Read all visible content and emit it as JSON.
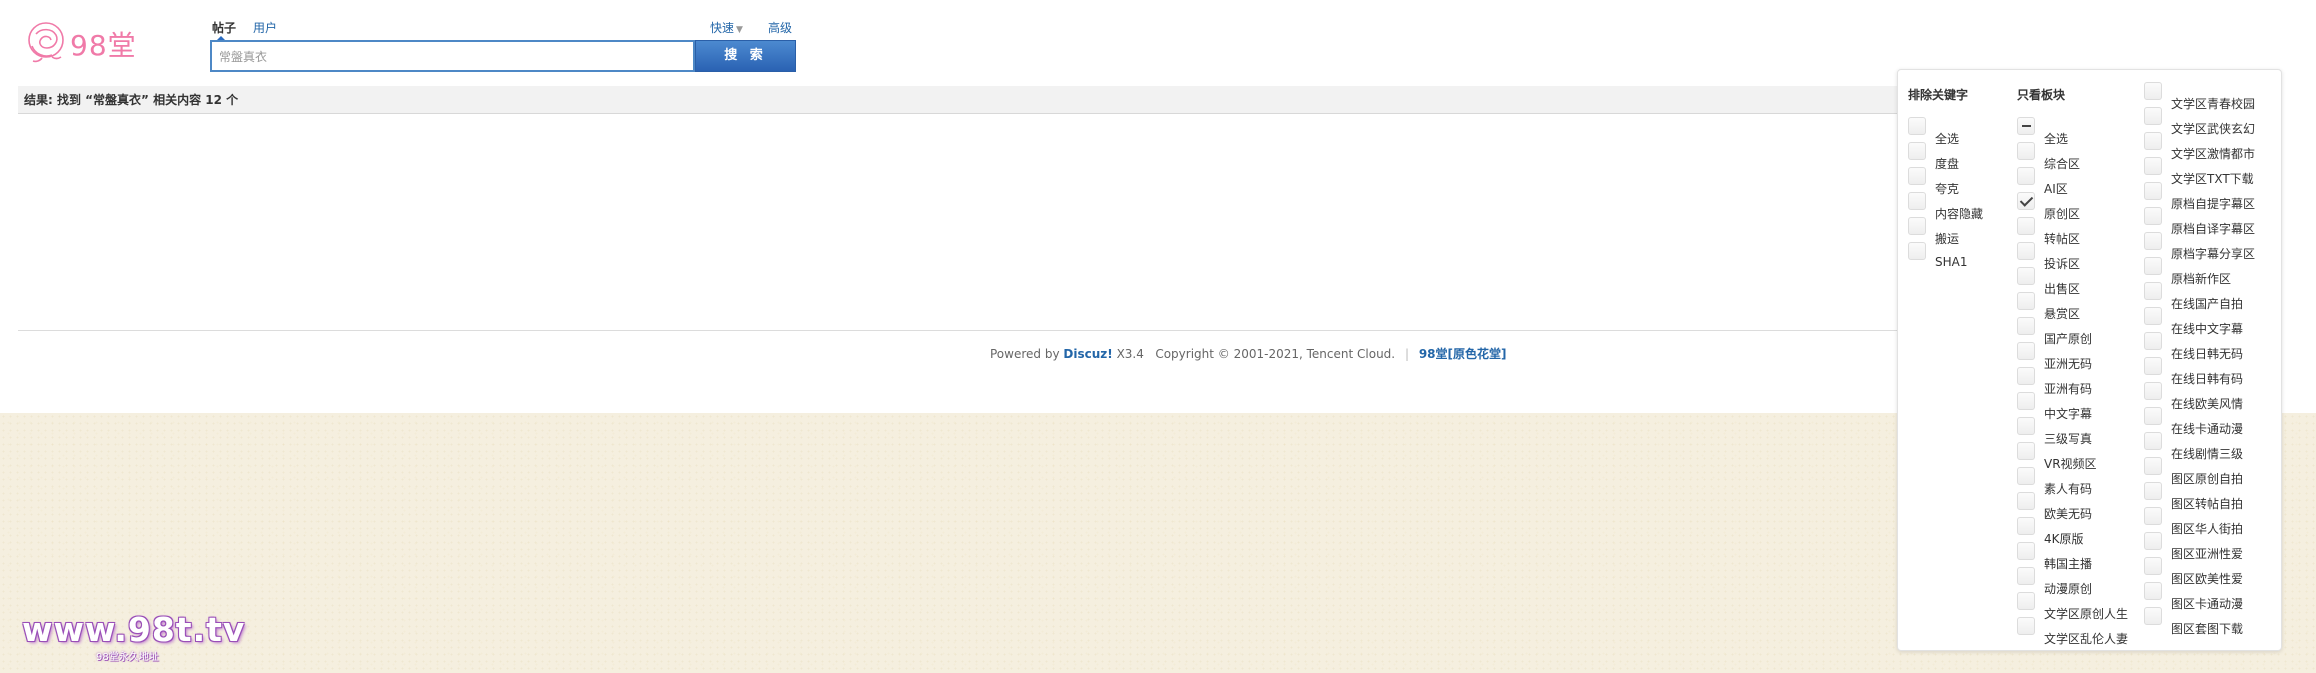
{
  "logo": {
    "text": "98堂"
  },
  "search": {
    "tabs": [
      {
        "label": "帖子",
        "active": true
      },
      {
        "label": "用户",
        "active": false
      }
    ],
    "query": "常盤真衣",
    "button_label": "搜 索",
    "quick_label": "快速",
    "advanced_label": "高级"
  },
  "result": {
    "summary": "结果: 找到 “常盤真衣” 相关内容 12 个"
  },
  "footer": {
    "powered_by": "Powered by",
    "discuz": "Discuz!",
    "version": "X3.4",
    "copyright": "Copyright © 2001-2021, Tencent Cloud.",
    "separator": "|",
    "site_name": "98堂[原色花堂]"
  },
  "watermark": {
    "main": "www.98t.tv",
    "sub": "98堂永久地址"
  },
  "filter": {
    "exclude_title": "排除关键字",
    "exclude_options": [
      {
        "label": "全选",
        "state": "unchecked"
      },
      {
        "label": "度盘",
        "state": "unchecked"
      },
      {
        "label": "夸克",
        "state": "unchecked"
      },
      {
        "label": "内容隐藏",
        "state": "unchecked"
      },
      {
        "label": "搬运",
        "state": "unchecked"
      },
      {
        "label": "SHA1",
        "state": "unchecked"
      }
    ],
    "only_title": "只看板块",
    "only_options": [
      {
        "label": "全选",
        "state": "indeterminate"
      },
      {
        "label": "综合区",
        "state": "unchecked"
      },
      {
        "label": "AI区",
        "state": "unchecked"
      },
      {
        "label": "原创区",
        "state": "checked"
      },
      {
        "label": "转帖区",
        "state": "unchecked"
      },
      {
        "label": "投诉区",
        "state": "unchecked"
      },
      {
        "label": "出售区",
        "state": "unchecked"
      },
      {
        "label": "悬赏区",
        "state": "unchecked"
      },
      {
        "label": "国产原创",
        "state": "unchecked"
      },
      {
        "label": "亚洲无码",
        "state": "unchecked"
      },
      {
        "label": "亚洲有码",
        "state": "unchecked"
      },
      {
        "label": "中文字幕",
        "state": "unchecked"
      },
      {
        "label": "三级写真",
        "state": "unchecked"
      },
      {
        "label": "VR视频区",
        "state": "unchecked"
      },
      {
        "label": "素人有码",
        "state": "unchecked"
      },
      {
        "label": "欧美无码",
        "state": "unchecked"
      },
      {
        "label": "4K原版",
        "state": "unchecked"
      },
      {
        "label": "韩国主播",
        "state": "unchecked"
      },
      {
        "label": "动漫原创",
        "state": "unchecked"
      },
      {
        "label": "文学区原创人生",
        "state": "unchecked"
      },
      {
        "label": "文学区乱伦人妻",
        "state": "unchecked"
      }
    ],
    "only_options_col2": [
      {
        "label": "文学区青春校园",
        "state": "unchecked"
      },
      {
        "label": "文学区武侠玄幻",
        "state": "unchecked"
      },
      {
        "label": "文学区激情都市",
        "state": "unchecked"
      },
      {
        "label": "文学区TXT下载",
        "state": "unchecked"
      },
      {
        "label": "原档自提字幕区",
        "state": "unchecked"
      },
      {
        "label": "原档自译字幕区",
        "state": "unchecked"
      },
      {
        "label": "原档字幕分享区",
        "state": "unchecked"
      },
      {
        "label": "原档新作区",
        "state": "unchecked"
      },
      {
        "label": "在线国产自拍",
        "state": "unchecked"
      },
      {
        "label": "在线中文字幕",
        "state": "unchecked"
      },
      {
        "label": "在线日韩无码",
        "state": "unchecked"
      },
      {
        "label": "在线日韩有码",
        "state": "unchecked"
      },
      {
        "label": "在线欧美风情",
        "state": "unchecked"
      },
      {
        "label": "在线卡通动漫",
        "state": "unchecked"
      },
      {
        "label": "在线剧情三级",
        "state": "unchecked"
      },
      {
        "label": "图区原创自拍",
        "state": "unchecked"
      },
      {
        "label": "图区转帖自拍",
        "state": "unchecked"
      },
      {
        "label": "图区华人街拍",
        "state": "unchecked"
      },
      {
        "label": "图区亚洲性爱",
        "state": "unchecked"
      },
      {
        "label": "图区欧美性爱",
        "state": "unchecked"
      },
      {
        "label": "图区卡通动漫",
        "state": "unchecked"
      },
      {
        "label": "图区套图下载",
        "state": "unchecked"
      }
    ]
  }
}
